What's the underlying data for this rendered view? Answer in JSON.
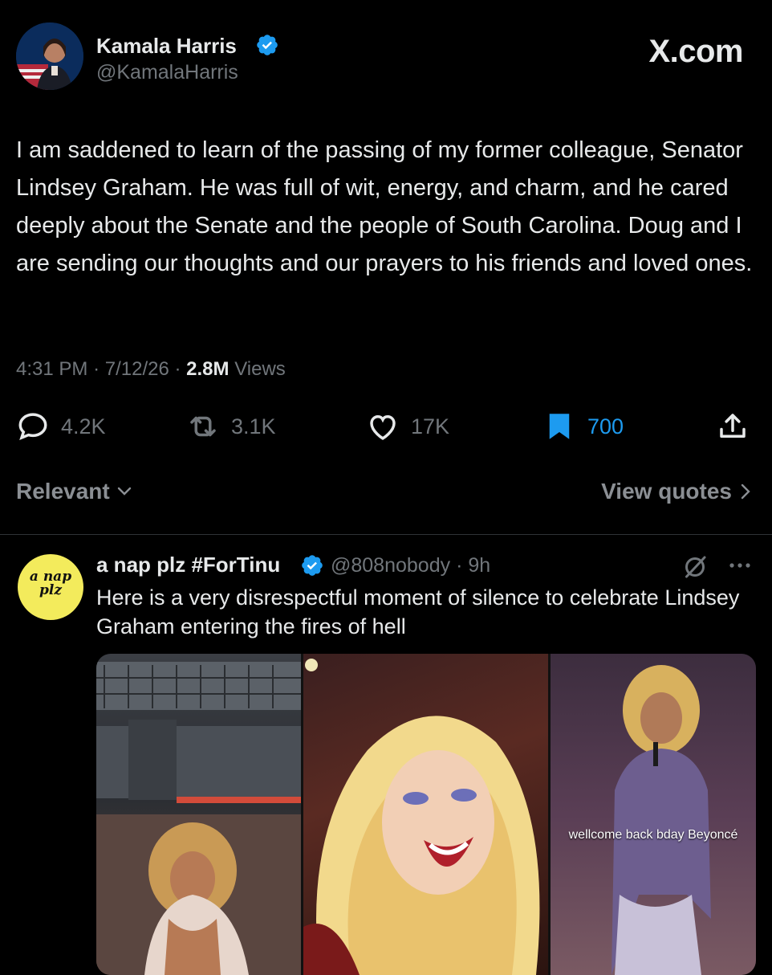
{
  "header": {
    "name": "Kamala Harris",
    "handle": "@KamalaHarris",
    "brand": "X.com"
  },
  "tweet": {
    "text": "I am saddened to learn of the passing of my former colleague, Senator Lindsey Graham. He was full of wit, energy, and charm, and he cared deeply about the Senate and the people of South Carolina. Doug and I are sending our thoughts and our prayers to his friends and loved ones.",
    "time": "4:31 PM",
    "date": "7/12/26",
    "views_count": "2.8M",
    "views_label": "Views"
  },
  "actions": {
    "replies": "4.2K",
    "retweets": "3.1K",
    "likes": "17K",
    "bookmarks": "700"
  },
  "sort": {
    "relevant_label": "Relevant",
    "view_quotes_label": "View quotes"
  },
  "reply": {
    "avatar_text": "a nap plz",
    "name": "a nap plz #ForTinu",
    "handle": "@808nobody",
    "age": "9h",
    "text": "Here is a very disrespectful moment of silence to celebrate Lindsey Graham entering the fires of hell",
    "media_caption": "wellcome back bday Beyoncé"
  },
  "icons": {
    "reply": "reply-bubble-icon",
    "retweet": "retweet-icon",
    "like": "heart-icon",
    "bookmark": "bookmark-icon",
    "share": "share-icon",
    "verified": "verified-badge-icon",
    "grok": "grok-icon",
    "more": "more-dots-icon"
  },
  "colors": {
    "background": "#000000",
    "text": "#e7e9ea",
    "muted": "#71767b",
    "accent": "#1d9bf0"
  }
}
